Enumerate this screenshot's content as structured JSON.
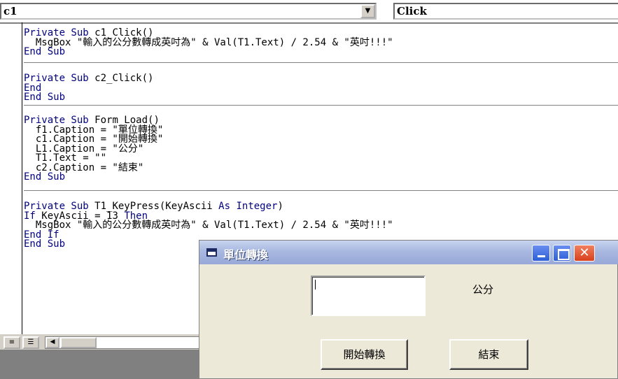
{
  "code_window": {
    "object_combo": "c1",
    "procedure_combo": "Click",
    "procedures": [
      {
        "lines": [
          [
            {
              "t": "Private Sub ",
              "k": true
            },
            {
              "t": "c1_Click()",
              "k": false
            }
          ],
          [
            {
              "t": "  MsgBox \"輸入的公分數轉成英吋為\" & Val(T1.Text) / 2.54 & \"英吋!!!\"",
              "k": false
            }
          ],
          [
            {
              "t": "End Sub",
              "k": true
            }
          ]
        ]
      },
      {
        "lines": [
          [
            {
              "t": "Private Sub ",
              "k": true
            },
            {
              "t": "c2_Click()",
              "k": false
            }
          ],
          [
            {
              "t": "End",
              "k": true
            }
          ],
          [
            {
              "t": "End Sub",
              "k": true
            }
          ]
        ]
      },
      {
        "lines": [
          [
            {
              "t": "Private Sub ",
              "k": true
            },
            {
              "t": "Form_Load()",
              "k": false
            }
          ],
          [
            {
              "t": "  f1.Caption = \"單位轉換\"",
              "k": false
            }
          ],
          [
            {
              "t": "  c1.Caption = \"開始轉換\"",
              "k": false
            }
          ],
          [
            {
              "t": "  L1.Caption = \"公分\"",
              "k": false
            }
          ],
          [
            {
              "t": "  T1.Text = \"\"",
              "k": false
            }
          ],
          [
            {
              "t": "  c2.Caption = \"結束\"",
              "k": false
            }
          ],
          [
            {
              "t": "End Sub",
              "k": true
            }
          ]
        ]
      },
      {
        "lines": [
          [
            {
              "t": "Private Sub ",
              "k": true
            },
            {
              "t": "T1_KeyPress(KeyAscii ",
              "k": false
            },
            {
              "t": "As Integer",
              "k": true
            },
            {
              "t": ")",
              "k": false
            }
          ],
          [
            {
              "t": "If ",
              "k": true
            },
            {
              "t": "KeyAscii = 13 ",
              "k": false
            },
            {
              "t": "Then",
              "k": true
            }
          ],
          [
            {
              "t": "  MsgBox \"輸入的公分數轉成英吋為\" & Val(T1.Text) / 2.54 & \"英吋!!!\"",
              "k": false
            }
          ],
          [
            {
              "t": "End If",
              "k": true
            }
          ],
          [
            {
              "t": "End Sub",
              "k": true
            }
          ]
        ]
      }
    ]
  },
  "form": {
    "title": "單位轉換",
    "textbox_value": "",
    "label": "公分",
    "button_start": "開始轉換",
    "button_end": "結束"
  },
  "colors": {
    "keyword": "#000080",
    "text": "#000000"
  }
}
